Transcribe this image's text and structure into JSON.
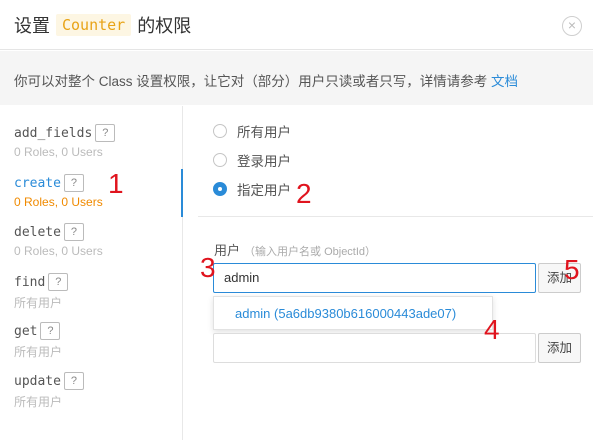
{
  "header": {
    "title_prefix": "设置",
    "class_name": "Counter",
    "title_suffix": "的权限",
    "close_icon": "×"
  },
  "notice": {
    "text": "你可以对整个 Class 设置权限，让它对（部分）用户只读或者只写，详情请参考 ",
    "link": "文档"
  },
  "permissions": [
    {
      "name": "add_fields",
      "help": "?",
      "summary": "0 Roles, 0 Users",
      "active": false
    },
    {
      "name": "create",
      "help": "?",
      "summary": "0 Roles, 0 Users",
      "active": true
    },
    {
      "name": "delete",
      "help": "?",
      "summary": "0 Roles, 0 Users",
      "active": false
    },
    {
      "name": "find",
      "help": "?",
      "summary": "所有用户",
      "active": false
    },
    {
      "name": "get",
      "help": "?",
      "summary": "所有用户",
      "active": false
    },
    {
      "name": "update",
      "help": "?",
      "summary": "所有用户",
      "active": false
    }
  ],
  "access_options": [
    {
      "label": "所有用户",
      "checked": false
    },
    {
      "label": "登录用户",
      "checked": false
    },
    {
      "label": "指定用户",
      "checked": true
    }
  ],
  "user_section": {
    "label": "用户",
    "hint": "（输入用户名或 ObjectId）",
    "input_value": "admin",
    "add_button": "添加",
    "suggestion": "admin (5a6db9380b616000443ade07)",
    "second_add_button": "添加"
  },
  "annotations": [
    "1",
    "2",
    "3",
    "4",
    "5"
  ],
  "colors": {
    "accent": "#2a8bd8",
    "active_summary": "#f08a00",
    "annotation": "#e0141e",
    "class_name_bg": "#fdf6e3",
    "class_name_fg": "#e8a317"
  }
}
